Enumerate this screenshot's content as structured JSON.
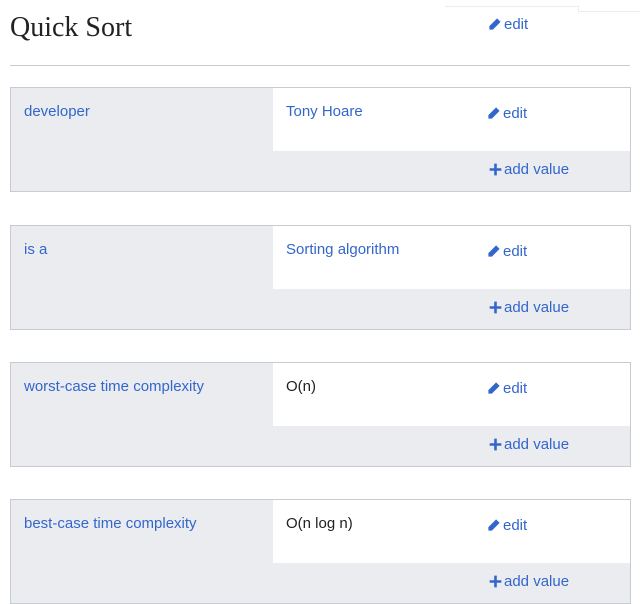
{
  "page": {
    "title": "Quick Sort",
    "title_edit_label": "edit"
  },
  "statements": [
    {
      "property": "developer",
      "value": "Tony Hoare",
      "value_is_link": true,
      "edit_label": "edit",
      "add_label": "add value"
    },
    {
      "property": "is a",
      "value": "Sorting algorithm",
      "value_is_link": true,
      "edit_label": "edit",
      "add_label": "add value"
    },
    {
      "property": "worst-case time complexity",
      "value": "O(n)",
      "value_is_link": false,
      "edit_label": "edit",
      "add_label": "add value"
    },
    {
      "property": "best-case time complexity",
      "value": "O(n log n)",
      "value_is_link": false,
      "edit_label": "edit",
      "add_label": "add value"
    }
  ],
  "icons": {
    "edit": "pencil-icon",
    "add": "plus-icon"
  },
  "colors": {
    "link": "#3366cc",
    "panel": "#eaecf0",
    "border": "#c8ccd1"
  }
}
